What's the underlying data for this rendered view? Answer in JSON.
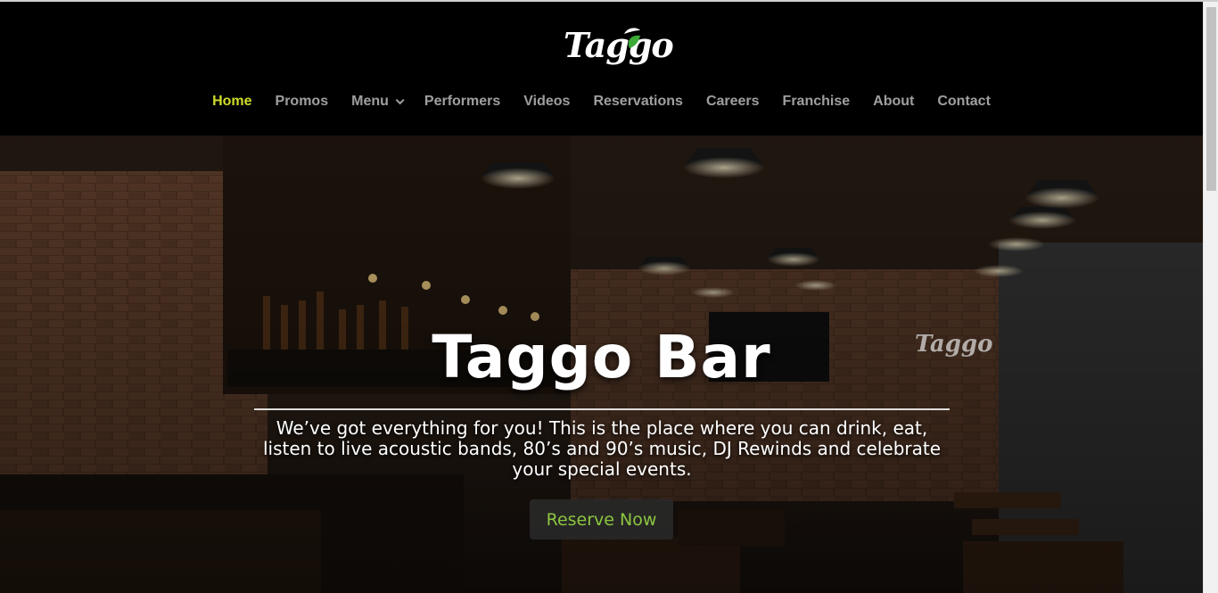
{
  "brand": {
    "logo_text": "Taggo"
  },
  "nav": {
    "items": [
      {
        "label": "Home",
        "active": true
      },
      {
        "label": "Promos"
      },
      {
        "label": "Menu",
        "has_dropdown": true
      },
      {
        "label": "Performers"
      },
      {
        "label": "Videos"
      },
      {
        "label": "Reservations"
      },
      {
        "label": "Careers"
      },
      {
        "label": "Franchise"
      },
      {
        "label": "About"
      },
      {
        "label": "Contact"
      }
    ]
  },
  "hero": {
    "title": "Taggo Bar",
    "description": "We’ve got everything for you! This is the place where you can drink, eat, listen to live acoustic bands, 80’s and 90’s music, DJ Rewinds and celebrate your special events.",
    "cta_label": "Reserve Now",
    "wall_sign": "Taggo"
  },
  "colors": {
    "accent_active": "#cfdc29",
    "cta_text": "#8cc63f",
    "header_bg": "#000000"
  }
}
